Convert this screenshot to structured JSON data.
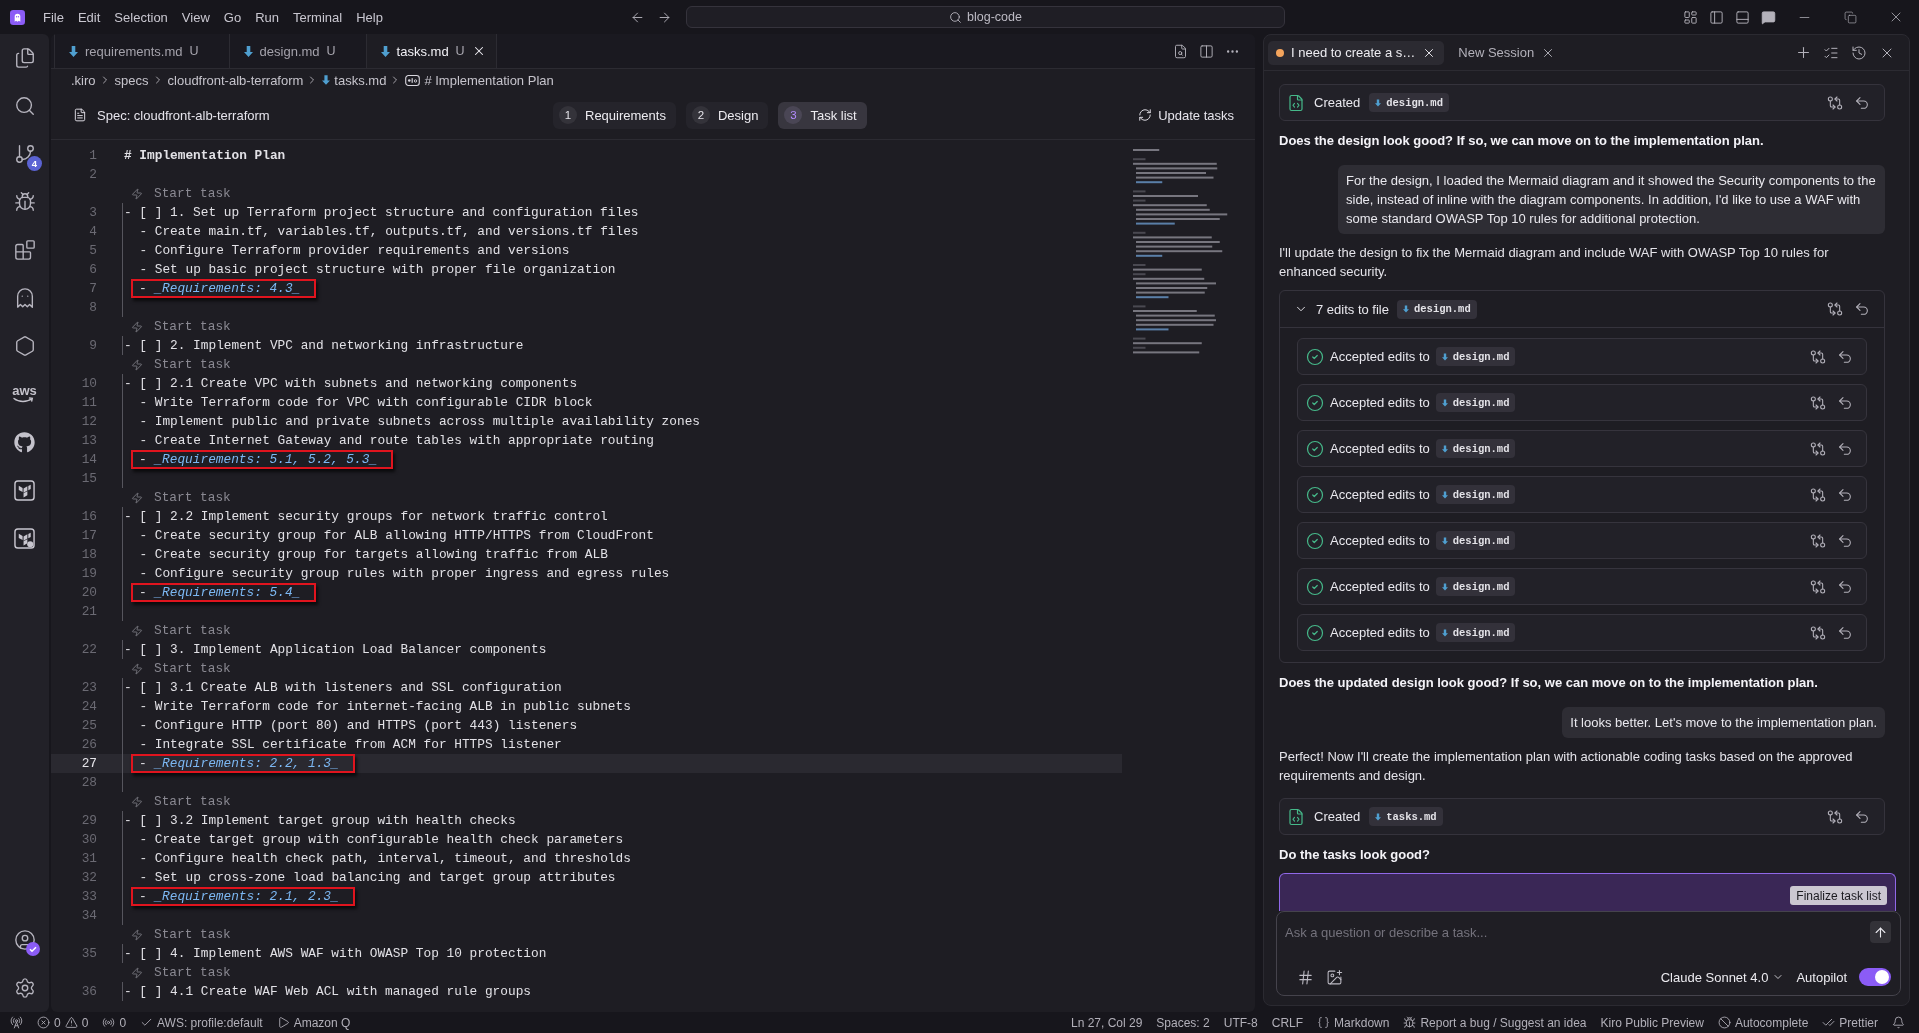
{
  "title_bar": {
    "menu": [
      "File",
      "Edit",
      "Selection",
      "View",
      "Go",
      "Run",
      "Terminal",
      "Help"
    ],
    "search": "blog-code"
  },
  "activity_bar": {
    "source_control_badge": "4",
    "aws_label": "aws"
  },
  "editor": {
    "tabs": [
      {
        "label": "requirements.md",
        "status": "U",
        "selected": false
      },
      {
        "label": "design.md",
        "status": "U",
        "selected": false
      },
      {
        "label": "tasks.md",
        "status": "U",
        "selected": true
      }
    ],
    "breadcrumb": [
      {
        "label": ".kiro",
        "kind": "folder"
      },
      {
        "label": "specs",
        "kind": "folder"
      },
      {
        "label": "cloudfront-alb-terraform",
        "kind": "folder"
      },
      {
        "label": "tasks.md",
        "kind": "file"
      },
      {
        "label": "# Implementation Plan",
        "kind": "symbol"
      }
    ],
    "spec": {
      "title": "Spec: cloudfront-alb-terraform",
      "steps": [
        {
          "number": "1",
          "label": "Requirements",
          "selected": false
        },
        {
          "number": "2",
          "label": "Design",
          "selected": false
        },
        {
          "number": "3",
          "label": "Task list",
          "selected": true
        }
      ],
      "update_button": "Update tasks"
    },
    "lines": [
      {
        "kind": "heading",
        "number": "1",
        "text": "# Implementation Plan",
        "current": false
      },
      {
        "kind": "blank",
        "number": "2",
        "current": false
      },
      {
        "kind": "codelens",
        "text": "Start task"
      },
      {
        "kind": "task",
        "number": "3",
        "text": "- [ ] 1. Set up Terraform project structure and configuration files",
        "current": false
      },
      {
        "kind": "detail",
        "number": "4",
        "text": "- Create main.tf, variables.tf, outputs.tf, and versions.tf files",
        "current": false
      },
      {
        "kind": "detail",
        "number": "5",
        "text": "- Configure Terraform provider requirements and versions",
        "current": false
      },
      {
        "kind": "detail",
        "number": "6",
        "text": "- Set up basic project structure with proper file organization",
        "current": false
      },
      {
        "kind": "requirements",
        "number": "7",
        "bullet": "-",
        "text": "_Requirements: 4.3_",
        "highlighted": true,
        "current": false
      },
      {
        "kind": "blank",
        "number": "8",
        "current": false
      },
      {
        "kind": "codelens",
        "text": "Start task"
      },
      {
        "kind": "task",
        "number": "9",
        "text": "- [ ] 2. Implement VPC and networking infrastructure",
        "current": false
      },
      {
        "kind": "codelens",
        "text": "Start task"
      },
      {
        "kind": "task",
        "number": "10",
        "text": "- [ ] 2.1 Create VPC with subnets and networking components",
        "current": false
      },
      {
        "kind": "detail",
        "number": "11",
        "text": "- Write Terraform code for VPC with configurable CIDR block",
        "current": false
      },
      {
        "kind": "detail",
        "number": "12",
        "text": "- Implement public and private subnets across multiple availability zones",
        "current": false
      },
      {
        "kind": "detail",
        "number": "13",
        "text": "- Create Internet Gateway and route tables with appropriate routing",
        "current": false
      },
      {
        "kind": "requirements",
        "number": "14",
        "bullet": "-",
        "text": "_Requirements: 5.1, 5.2, 5.3_",
        "highlighted": true,
        "current": false
      },
      {
        "kind": "blank",
        "number": "15",
        "current": false
      },
      {
        "kind": "codelens",
        "text": "Start task"
      },
      {
        "kind": "task",
        "number": "16",
        "text": "- [ ] 2.2 Implement security groups for network traffic control",
        "current": false
      },
      {
        "kind": "detail",
        "number": "17",
        "text": "- Create security group for ALB allowing HTTP/HTTPS from CloudFront",
        "current": false
      },
      {
        "kind": "detail",
        "number": "18",
        "text": "- Create security group for targets allowing traffic from ALB",
        "current": false
      },
      {
        "kind": "detail",
        "number": "19",
        "text": "- Configure security group rules with proper ingress and egress rules",
        "current": false
      },
      {
        "kind": "requirements",
        "number": "20",
        "bullet": "-",
        "text": "_Requirements: 5.4_",
        "highlighted": true,
        "current": false
      },
      {
        "kind": "blank",
        "number": "21",
        "current": false
      },
      {
        "kind": "codelens",
        "text": "Start task"
      },
      {
        "kind": "task",
        "number": "22",
        "text": "- [ ] 3. Implement Application Load Balancer components",
        "current": false
      },
      {
        "kind": "codelens",
        "text": "Start task"
      },
      {
        "kind": "task",
        "number": "23",
        "text": "- [ ] 3.1 Create ALB with listeners and SSL configuration",
        "current": false
      },
      {
        "kind": "detail",
        "number": "24",
        "text": "- Write Terraform code for internet-facing ALB in public subnets",
        "current": false
      },
      {
        "kind": "detail",
        "number": "25",
        "text": "- Configure HTTP (port 80) and HTTPS (port 443) listeners",
        "current": false
      },
      {
        "kind": "detail",
        "number": "26",
        "text": "- Integrate SSL certificate from ACM for HTTPS listener",
        "current": false
      },
      {
        "kind": "requirements",
        "number": "27",
        "bullet": "-",
        "text": "_Requirements: 2.2, 1.3_",
        "highlighted": true,
        "current": true
      },
      {
        "kind": "blank",
        "number": "28",
        "current": false
      },
      {
        "kind": "codelens",
        "text": "Start task"
      },
      {
        "kind": "task",
        "number": "29",
        "text": "- [ ] 3.2 Implement target group with health checks",
        "current": false
      },
      {
        "kind": "detail",
        "number": "30",
        "text": "- Create target group with configurable health check parameters",
        "current": false
      },
      {
        "kind": "detail",
        "number": "31",
        "text": "- Configure health check path, interval, timeout, and thresholds",
        "current": false
      },
      {
        "kind": "detail",
        "number": "32",
        "text": "- Set up cross-zone load balancing and target group attributes",
        "current": false
      },
      {
        "kind": "requirements",
        "number": "33",
        "bullet": "-",
        "text": "_Requirements: 2.1, 2.3_",
        "highlighted": true,
        "current": false
      },
      {
        "kind": "blank",
        "number": "34",
        "current": false
      },
      {
        "kind": "codelens",
        "text": "Start task"
      },
      {
        "kind": "task",
        "number": "35",
        "text": "- [ ] 4. Implement AWS WAF with OWASP Top 10 protection",
        "current": false
      },
      {
        "kind": "codelens",
        "text": "Start task"
      },
      {
        "kind": "task",
        "number": "36",
        "text": "- [ ] 4.1 Create WAF Web ACL with managed rule groups",
        "current": false
      }
    ]
  },
  "chat": {
    "tabs": [
      {
        "label": "I need to create a s…",
        "busy": true,
        "selected": true
      },
      {
        "label": "New Session",
        "busy": false,
        "selected": false
      }
    ],
    "messages": [
      {
        "kind": "file_card",
        "action": "Created",
        "file": "design.md"
      },
      {
        "kind": "question",
        "text": "Does the design look good? If so, we can move on to the implementation plan."
      },
      {
        "kind": "user",
        "text": "For the design, I loaded the Mermaid diagram and it showed the Security components to the side, instead of inline with the diagram components. In addition, I'd like to use a WAF with some standard OWASP Top 10 rules for additional protection."
      },
      {
        "kind": "assistant",
        "text": "I'll update the design to fix the Mermaid diagram and include WAF with OWASP Top 10 rules for enhanced security."
      },
      {
        "kind": "edit_group",
        "title": "7 edits to file",
        "file": "design.md",
        "expanded": true,
        "edits": [
          {
            "action": "Accepted edits to",
            "file": "design.md"
          },
          {
            "action": "Accepted edits to",
            "file": "design.md"
          },
          {
            "action": "Accepted edits to",
            "file": "design.md"
          },
          {
            "action": "Accepted edits to",
            "file": "design.md"
          },
          {
            "action": "Accepted edits to",
            "file": "design.md"
          },
          {
            "action": "Accepted edits to",
            "file": "design.md"
          },
          {
            "action": "Accepted edits to",
            "file": "design.md"
          }
        ]
      },
      {
        "kind": "question",
        "text": "Does the updated design look good? If so, we can move on to the implementation plan."
      },
      {
        "kind": "user",
        "text": "It looks better. Let's move to the implementation plan."
      },
      {
        "kind": "assistant",
        "text": "Perfect! Now I'll create the implementation plan with actionable coding tasks based on the approved requirements and design."
      },
      {
        "kind": "file_card",
        "action": "Created",
        "file": "tasks.md"
      },
      {
        "kind": "question",
        "text": "Do the tasks look good?"
      },
      {
        "kind": "action_box",
        "button": "Finalize task list"
      }
    ],
    "input": {
      "placeholder": "Ask a question or describe a task...",
      "model": "Claude Sonnet 4.0",
      "autopilot_label": "Autopilot",
      "autopilot": true
    }
  },
  "status_bar": {
    "left": [
      {
        "kind": "remote"
      },
      {
        "kind": "problems",
        "errors": "0",
        "warnings": "0"
      },
      {
        "kind": "ports",
        "text": "0"
      },
      {
        "kind": "check",
        "text": "AWS: profile:default"
      },
      {
        "kind": "play",
        "text": "Amazon Q"
      }
    ],
    "right": [
      {
        "kind": "plain",
        "text": "Ln 27, Col 29"
      },
      {
        "kind": "plain",
        "text": "Spaces: 2"
      },
      {
        "kind": "plain",
        "text": "UTF-8"
      },
      {
        "kind": "plain",
        "text": "CRLF"
      },
      {
        "kind": "braces",
        "text": "Markdown"
      },
      {
        "kind": "bug",
        "text": "Report a bug / Suggest an idea"
      },
      {
        "kind": "plain",
        "text": "Kiro Public Preview"
      },
      {
        "kind": "ban",
        "text": "Autocomplete"
      },
      {
        "kind": "double_check",
        "text": "Prettier"
      },
      {
        "kind": "bell"
      }
    ]
  }
}
